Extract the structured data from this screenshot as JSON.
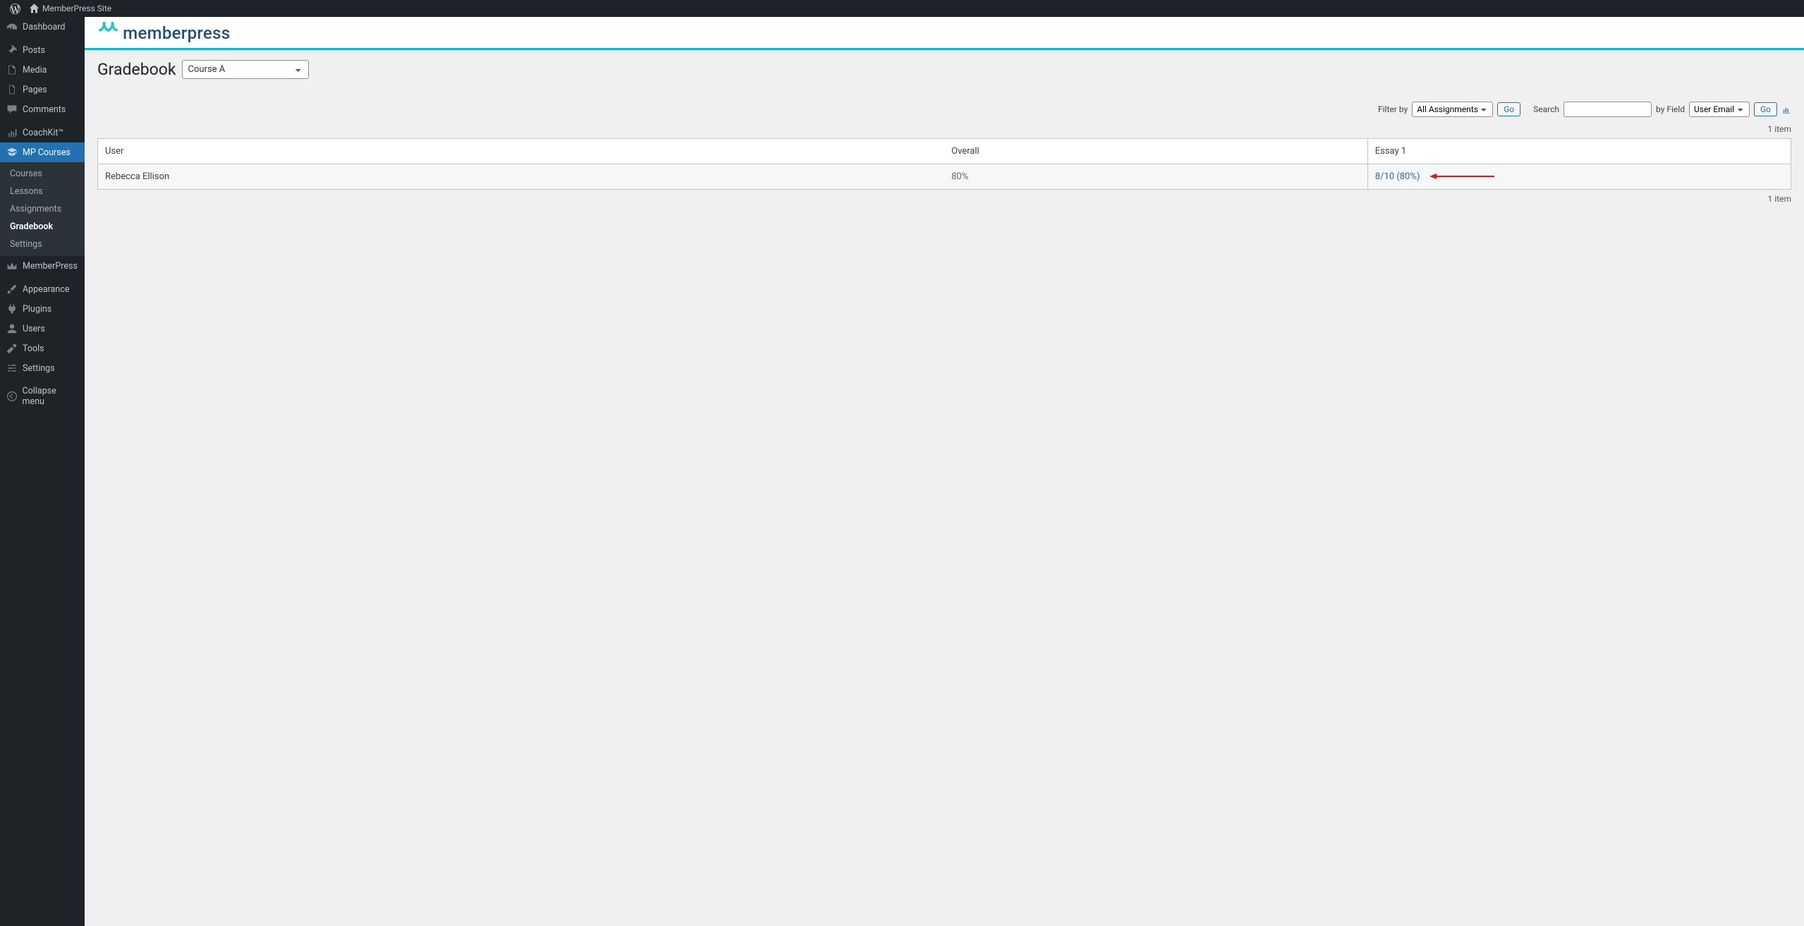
{
  "adminbar": {
    "site_name": "MemberPress Site"
  },
  "sidebar": {
    "items": [
      {
        "label": "Dashboard"
      },
      {
        "label": "Posts"
      },
      {
        "label": "Media"
      },
      {
        "label": "Pages"
      },
      {
        "label": "Comments"
      },
      {
        "label": "CoachKit™"
      },
      {
        "label": "MP Courses"
      },
      {
        "label": "MemberPress"
      },
      {
        "label": "Appearance"
      },
      {
        "label": "Plugins"
      },
      {
        "label": "Users"
      },
      {
        "label": "Tools"
      },
      {
        "label": "Settings"
      },
      {
        "label": "Collapse menu"
      }
    ],
    "mpcourses_sub": [
      {
        "label": "Courses"
      },
      {
        "label": "Lessons"
      },
      {
        "label": "Assignments"
      },
      {
        "label": "Gradebook"
      },
      {
        "label": "Settings"
      }
    ]
  },
  "brand": {
    "logo_text": "memberpress"
  },
  "page": {
    "title": "Gradebook",
    "course_selected": "Course A"
  },
  "filters": {
    "filter_by_label": "Filter by",
    "filter_selected": "All Assignments",
    "go_label": "Go",
    "search_label": "Search",
    "search_value": "",
    "by_field_label": "by Field",
    "field_selected": "User Email",
    "go2_label": "Go"
  },
  "table": {
    "count_text": "1 item",
    "headers": {
      "user": "User",
      "overall": "Overall",
      "essay": "Essay 1"
    },
    "rows": [
      {
        "user": "Rebecca Ellison",
        "overall": "80%",
        "essay": "8/10 (80%)"
      }
    ]
  }
}
